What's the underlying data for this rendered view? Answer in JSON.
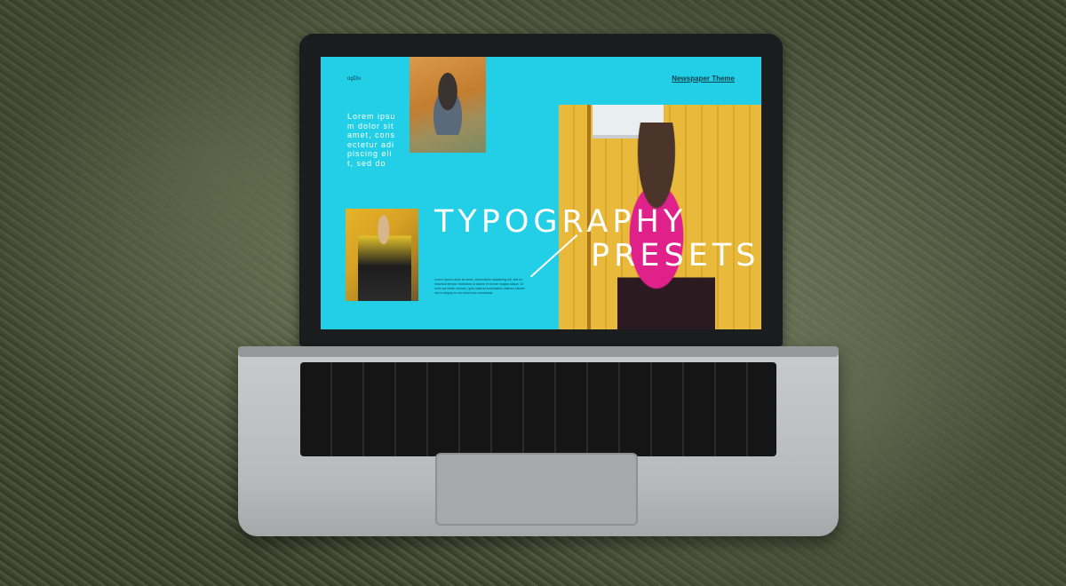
{
  "screen": {
    "brand": "ogDiv",
    "theme_label": "Newspaper Theme",
    "lorem": "Lorem ipsum dolor sit amet, consectetur adipiscing elit, sed do",
    "title_line1": "TYPOGRAPHY",
    "title_line2": "PRESETS",
    "body_text": "Lorem ipsum dolor sit amet, consectetur adipiscing elit, sed do eiusmod tempor incididunt ut labore et dolore magna aliqua. Ut enim ad minim veniam, quis nostrud exercitation ullamco laboris nisi ut aliquip ex ea commodo consequat."
  },
  "colors": {
    "screen_background": "#22cfe6",
    "title_text": "#ffffff",
    "accent_pink": "#e0218a",
    "accent_yellow": "#e8b93a"
  }
}
